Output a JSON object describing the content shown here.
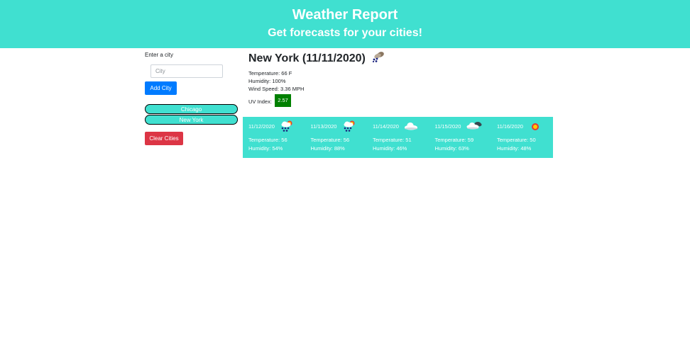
{
  "header": {
    "title": "Weather Report",
    "subtitle": "Get forecasts for your cities!"
  },
  "sidebar": {
    "enter_label": "Enter a city",
    "input_placeholder": "City",
    "input_value": "",
    "add_button": "Add City",
    "cities": [
      "Chicago",
      "New York"
    ],
    "clear_button": "Clear Cities"
  },
  "current": {
    "heading": "New York (11/11/2020)",
    "icon": "rain-cloud-icon",
    "temperature": "Temperature: 66 F",
    "humidity": "Humidity: 100%",
    "wind": "Wind Speed: 3.36 MPH",
    "uv_label": "UV Index:",
    "uv_value": "2.57",
    "uv_color": "#008000"
  },
  "forecast": [
    {
      "date": "11/12/2020",
      "icon": "sun-rain-cloud-icon",
      "temp": "Temperature: 56",
      "humidity": "Humidity: 54%"
    },
    {
      "date": "11/13/2020",
      "icon": "sun-rain-cloud-icon",
      "temp": "Temperature: 56",
      "humidity": "Humidity: 88%"
    },
    {
      "date": "11/14/2020",
      "icon": "cloud-icon",
      "temp": "Temperature: 51",
      "humidity": "Humidity: 46%"
    },
    {
      "date": "11/15/2020",
      "icon": "clouds-icon",
      "temp": "Temperature: 59",
      "humidity": "Humidity: 63%"
    },
    {
      "date": "11/16/2020",
      "icon": "sun-icon",
      "temp": "Temperature: 50",
      "humidity": "Humidity: 48%"
    }
  ],
  "colors": {
    "accent": "#40e0d0",
    "primary_button": "#007bff",
    "danger_button": "#dc3545"
  }
}
